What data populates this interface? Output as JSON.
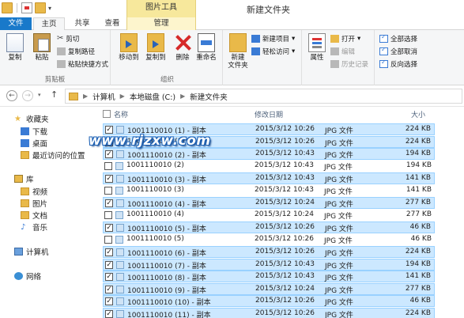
{
  "titlebar": {
    "tools_tab": "图片工具",
    "window_title": "新建文件夹"
  },
  "tabs": {
    "file": "文件",
    "home": "主页",
    "share": "共享",
    "view": "查看",
    "manage": "管理"
  },
  "ribbon": {
    "clipboard": {
      "copy": "复制",
      "paste": "粘贴",
      "cut": "剪切",
      "copy_path": "复制路径",
      "paste_shortcut": "粘贴快捷方式",
      "group": "剪贴板"
    },
    "organize": {
      "move_to": "移动到",
      "copy_to": "复制到",
      "delete": "删除",
      "rename": "重命名",
      "group": "组织"
    },
    "new": {
      "new_folder_line1": "新建",
      "new_folder_line2": "文件夹",
      "new_item": "新建项目",
      "easy_access": "轻松访问"
    },
    "open": {
      "properties": "属性",
      "open": "打开",
      "edit": "编辑",
      "history": "历史记录"
    },
    "select": {
      "select_all": "全部选择",
      "select_none": "全部取消",
      "invert": "反向选择"
    }
  },
  "address": {
    "computer": "计算机",
    "drive": "本地磁盘 (C:)",
    "folder": "新建文件夹"
  },
  "navpane": {
    "favorites": "收藏夹",
    "downloads": "下载",
    "desktop": "桌面",
    "recent": "最近访问的位置",
    "libraries": "库",
    "videos": "视频",
    "pictures": "图片",
    "documents": "文档",
    "music": "音乐",
    "computer": "计算机",
    "network": "网络"
  },
  "columns": {
    "name": "名称",
    "date": "修改日期",
    "size": "大小"
  },
  "watermark": "www.rjzxw.com",
  "files": [
    {
      "name": "1001110010 (1) - 副本",
      "date": "2015/3/12 10:26",
      "type": "JPG 文件",
      "size": "224 KB",
      "selected": true
    },
    {
      "name": "1001110010 (1)",
      "date": "2015/3/12 10:26",
      "type": "JPG 文件",
      "size": "224 KB",
      "selected": true
    },
    {
      "name": "1001110010 (2) - 副本",
      "date": "2015/3/12 10:43",
      "type": "JPG 文件",
      "size": "194 KB",
      "selected": true
    },
    {
      "name": "1001110010 (2)",
      "date": "2015/3/12 10:43",
      "type": "JPG 文件",
      "size": "194 KB",
      "selected": false
    },
    {
      "name": "1001110010 (3) - 副本",
      "date": "2015/3/12 10:43",
      "type": "JPG 文件",
      "size": "141 KB",
      "selected": true
    },
    {
      "name": "1001110010 (3)",
      "date": "2015/3/12 10:43",
      "type": "JPG 文件",
      "size": "141 KB",
      "selected": false
    },
    {
      "name": "1001110010 (4) - 副本",
      "date": "2015/3/12 10:24",
      "type": "JPG 文件",
      "size": "277 KB",
      "selected": true
    },
    {
      "name": "1001110010 (4)",
      "date": "2015/3/12 10:24",
      "type": "JPG 文件",
      "size": "277 KB",
      "selected": false
    },
    {
      "name": "1001110010 (5) - 副本",
      "date": "2015/3/12 10:26",
      "type": "JPG 文件",
      "size": "46 KB",
      "selected": true
    },
    {
      "name": "1001110010 (5)",
      "date": "2015/3/12 10:26",
      "type": "JPG 文件",
      "size": "46 KB",
      "selected": false
    },
    {
      "name": "1001110010 (6) - 副本",
      "date": "2015/3/12 10:26",
      "type": "JPG 文件",
      "size": "224 KB",
      "selected": true
    },
    {
      "name": "1001110010 (7) - 副本",
      "date": "2015/3/12 10:43",
      "type": "JPG 文件",
      "size": "194 KB",
      "selected": true
    },
    {
      "name": "1001110010 (8) - 副本",
      "date": "2015/3/12 10:43",
      "type": "JPG 文件",
      "size": "141 KB",
      "selected": true
    },
    {
      "name": "1001110010 (9) - 副本",
      "date": "2015/3/12 10:24",
      "type": "JPG 文件",
      "size": "277 KB",
      "selected": true
    },
    {
      "name": "1001110010 (10) - 副本",
      "date": "2015/3/12 10:26",
      "type": "JPG 文件",
      "size": "46 KB",
      "selected": true
    },
    {
      "name": "1001110010 (11) - 副本",
      "date": "2015/3/12 10:26",
      "type": "JPG 文件",
      "size": "224 KB",
      "selected": true
    }
  ]
}
